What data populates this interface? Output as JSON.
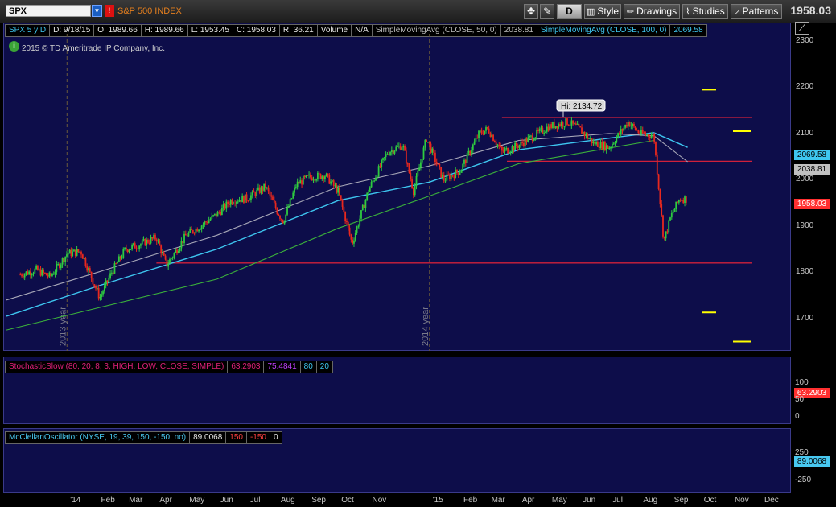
{
  "toolbar": {
    "symbol": "SPX",
    "symbol_name": "S&P 500 INDEX",
    "period_button": "D",
    "style_label": "Style",
    "drawings_label": "Drawings",
    "studies_label": "Studies",
    "patterns_label": "Patterns",
    "last_price": "1958.03"
  },
  "price_header": {
    "chart_label": "SPX 5 y D",
    "date": "D: 9/18/15",
    "open": "O: 1989.66",
    "high": "H: 1989.66",
    "low": "L: 1953.45",
    "close": "C: 1958.03",
    "range": "R: 36.21",
    "volume_label": "Volume",
    "volume_value": "N/A",
    "sma50_label": "SimpleMovingAvg (CLOSE, 50, 0)",
    "sma50_value": "2038.81",
    "sma100_label": "SimpleMovingAvg (CLOSE, 100, 0)",
    "sma100_value": "2069.58"
  },
  "copyright": "2015 © TD Ameritrade IP Company, Inc.",
  "info_icon": "i",
  "scroll_icon": "trend-line-icon",
  "hi_annotation": "Hi: 2134.72",
  "year_labels": [
    "2013 year",
    "2014 year"
  ],
  "price_boxes": {
    "sma100": {
      "label": "2069.58",
      "color": "#3ec6f0"
    },
    "sma50": {
      "label": "2038.81",
      "color": "#c0c0c0"
    },
    "last": {
      "label": "1958.03",
      "color": "#ff3030"
    }
  },
  "stoch_header": {
    "label": "StochasticSlow (80, 20, 8, 3, HIGH, LOW, CLOSE, SIMPLE)",
    "k_value": "63.2903",
    "d_value": "75.4841",
    "overbought": "80",
    "oversold": "20"
  },
  "stoch_box": "63.2903",
  "stoch_axis": [
    "100",
    "50",
    "0"
  ],
  "mcclellan_header": {
    "label": "McClellanOscillator (NYSE, 19, 39, 150, -150, no)",
    "value": "89.0068",
    "upper": "150",
    "lower": "-150",
    "zero": "0"
  },
  "mcclellan_box": "89.0068",
  "mcclellan_axis": [
    "250",
    "-250"
  ],
  "colors": {
    "background": "#0d0d4a",
    "up_candle": "#2ecc40",
    "down_candle": "#e8281e",
    "sma100": "#3ec6f0",
    "sma50": "#a8a8b8",
    "sma200": "#3bb03b",
    "stoch_k": "#e0207a",
    "mcclellan": "#48c8f0",
    "level_line": "#d0203a",
    "target_marks": "#ffff00"
  },
  "chart_data": {
    "type": "line",
    "title": "SPX 5 y D",
    "x_axis_ticks": [
      "'14",
      "Feb",
      "Mar",
      "Apr",
      "May",
      "Jun",
      "Jul",
      "Aug",
      "Sep",
      "Oct",
      "Nov",
      "'15",
      "Feb",
      "Mar",
      "Apr",
      "May",
      "Jun",
      "Jul",
      "Aug",
      "Sep",
      "Oct",
      "Nov",
      "Dec"
    ],
    "y_axis_ticks": [
      2300,
      2200,
      2100,
      2000,
      1900,
      1800,
      1700
    ],
    "ylim": [
      1630,
      2340
    ],
    "horizontal_levels": [
      2134.72,
      2040,
      1820
    ],
    "target_marks": [
      2195,
      2105,
      1713,
      1650
    ],
    "series": [
      {
        "name": "SPX close",
        "x": [
          "2013-11-15",
          "2013-12-01",
          "2013-12-15",
          "2014-01-01",
          "2014-01-15",
          "2014-02-03",
          "2014-02-15",
          "2014-03-01",
          "2014-03-15",
          "2014-04-01",
          "2014-04-11",
          "2014-05-01",
          "2014-05-15",
          "2014-06-01",
          "2014-06-15",
          "2014-07-01",
          "2014-07-20",
          "2014-08-01",
          "2014-08-07",
          "2014-08-20",
          "2014-09-01",
          "2014-09-18",
          "2014-10-01",
          "2014-10-15",
          "2014-11-01",
          "2014-11-20",
          "2014-12-05",
          "2014-12-16",
          "2014-12-29",
          "2015-01-15",
          "2015-02-01",
          "2015-02-20",
          "2015-03-01",
          "2015-03-15",
          "2015-04-01",
          "2015-04-20",
          "2015-05-01",
          "2015-05-20",
          "2015-06-01",
          "2015-06-15",
          "2015-07-01",
          "2015-07-20",
          "2015-08-01",
          "2015-08-15",
          "2015-08-25",
          "2015-09-01",
          "2015-09-10",
          "2015-09-18"
        ],
        "values": [
          1795,
          1805,
          1790,
          1840,
          1845,
          1745,
          1800,
          1850,
          1860,
          1875,
          1815,
          1880,
          1900,
          1925,
          1955,
          1960,
          1985,
          1930,
          1910,
          1990,
          2005,
          2010,
          1975,
          1862,
          1980,
          2060,
          2075,
          1975,
          2090,
          2000,
          2020,
          2100,
          2110,
          2060,
          2075,
          2100,
          2115,
          2125,
          2110,
          2080,
          2070,
          2125,
          2100,
          2095,
          1867,
          1920,
          1960,
          1958
        ]
      },
      {
        "name": "SimpleMovingAvg (CLOSE, 100, 0)",
        "x": [
          "2013-11-01",
          "2014-02-01",
          "2014-06-01",
          "2014-10-01",
          "2015-01-01",
          "2015-04-01",
          "2015-07-01",
          "2015-08-15",
          "2015-09-18"
        ],
        "values": [
          1705,
          1770,
          1850,
          1955,
          1995,
          2065,
          2090,
          2102,
          2070
        ]
      },
      {
        "name": "SimpleMovingAvg (CLOSE, 50, 0)",
        "x": [
          "2013-11-01",
          "2014-02-01",
          "2014-06-01",
          "2014-10-01",
          "2015-01-01",
          "2015-04-01",
          "2015-07-01",
          "2015-08-15",
          "2015-09-18"
        ],
        "values": [
          1740,
          1800,
          1880,
          1985,
          2030,
          2085,
          2100,
          2095,
          2039
        ]
      },
      {
        "name": "SMA 200",
        "x": [
          "2013-11-01",
          "2014-06-01",
          "2014-10-01",
          "2015-01-01",
          "2015-04-01",
          "2015-08-15"
        ],
        "values": [
          1675,
          1785,
          1895,
          1965,
          2035,
          2085
        ]
      }
    ]
  }
}
